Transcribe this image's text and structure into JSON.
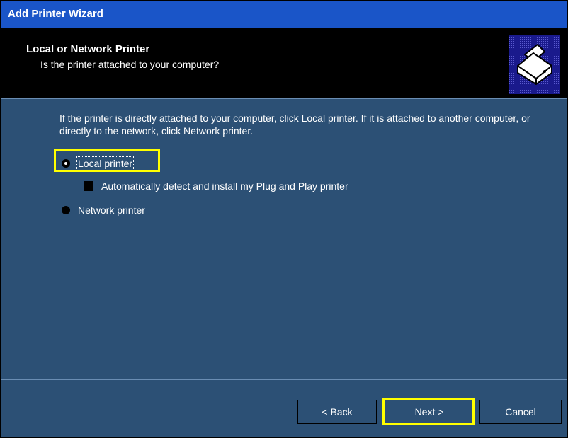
{
  "window": {
    "title": "Add Printer Wizard"
  },
  "header": {
    "title": "Local or Network Printer",
    "subtitle": "Is the printer attached to your computer?",
    "icon": "printer-icon"
  },
  "content": {
    "instructions": "If the printer is directly attached to your computer, click Local printer.  If it is attached to another computer, or directly to the network, click Network printer.",
    "options": [
      {
        "label": "Local printer",
        "selected": true
      },
      {
        "label": "Network printer",
        "selected": false
      }
    ],
    "auto_detect": {
      "label": "Automatically detect and install my Plug and Play printer",
      "checked": true
    }
  },
  "buttons": {
    "back": "< Back",
    "next": "Next >",
    "cancel": "Cancel"
  },
  "colors": {
    "titlebar": "#1a55c8",
    "body": "#2c5075",
    "header": "#000000",
    "highlight": "#ffff00"
  }
}
